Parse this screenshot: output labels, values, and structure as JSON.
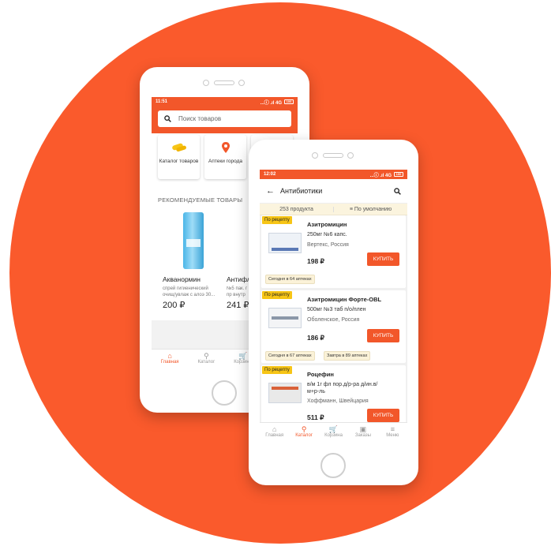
{
  "colors": {
    "brand": "#f2572a",
    "background_circle": "#fa5a2c",
    "prescription_badge": "#f7c516"
  },
  "back_phone": {
    "status": {
      "time": "11:51",
      "network": "...ⓘ .ıl 4G",
      "battery": "100"
    },
    "search": {
      "placeholder": "Поиск товаров",
      "icon": "search-icon"
    },
    "categories": [
      {
        "label": "Каталог товаров",
        "icon": "pills-icon"
      },
      {
        "label": "Аптеки города",
        "icon": "map-pin-icon"
      }
    ],
    "recommended_title": "РЕКОМЕНДУЕМЫЕ ТОВАРЫ",
    "products": [
      {
        "name": "Акванормин",
        "desc_1": "спрей гигиенический",
        "desc_2": "очищ/увлаж с алоэ 30...",
        "price": "200 ₽"
      },
      {
        "name": "Антифлу",
        "desc_1": "№5 пак. г",
        "desc_2": "пр внутр",
        "price": "241 ₽"
      }
    ],
    "tabs": [
      {
        "label": "Главная",
        "icon": "home-icon",
        "active": true
      },
      {
        "label": "Каталог",
        "icon": "catalog-icon",
        "active": false
      },
      {
        "label": "Корзина",
        "icon": "cart-icon",
        "active": false
      },
      {
        "label": "За",
        "icon": "orders-icon",
        "active": false
      }
    ]
  },
  "front_phone": {
    "status": {
      "time": "12:02",
      "network": "...ⓘ .ıl 4G",
      "battery": "100"
    },
    "title": "Антибиотики",
    "count_label": "253 продукта",
    "sort_label": "По умолчанию",
    "items": [
      {
        "badge": "По рецепту",
        "name": "Азитромицин",
        "dose_1": "250мг №6 капс.",
        "dose_2": "",
        "maker": "Вертекс, Россия",
        "price": "198 ₽",
        "buy": "КУПИТЬ",
        "availability": [
          "Сегодня в 64 аптеках"
        ]
      },
      {
        "badge": "По рецепту",
        "name": "Азитромицин Форте-OBL",
        "dose_1": "500мг №3 таб п/о/плен",
        "dose_2": "",
        "maker": "Оболенское, Россия",
        "price": "186 ₽",
        "buy": "КУПИТЬ",
        "availability": [
          "Сегодня в 67 аптеках",
          "Завтра в 89 аптеках"
        ]
      },
      {
        "badge": "По рецепту",
        "name": "Роцефин",
        "dose_1": "в/м 1г фл пор.д/р-ра д/ин.в/",
        "dose_2": "м+р-ль",
        "maker": "Хоффманн, Швейцария",
        "price": "511 ₽",
        "buy": "КУПИТЬ",
        "availability": []
      }
    ],
    "tabs": [
      {
        "label": "Главная",
        "icon": "home-icon",
        "active": false
      },
      {
        "label": "Каталог",
        "icon": "catalog-icon",
        "active": true
      },
      {
        "label": "Корзина",
        "icon": "cart-icon",
        "active": false
      },
      {
        "label": "Заказы",
        "icon": "orders-icon",
        "active": false
      },
      {
        "label": "Меню",
        "icon": "menu-icon",
        "active": false
      }
    ]
  }
}
